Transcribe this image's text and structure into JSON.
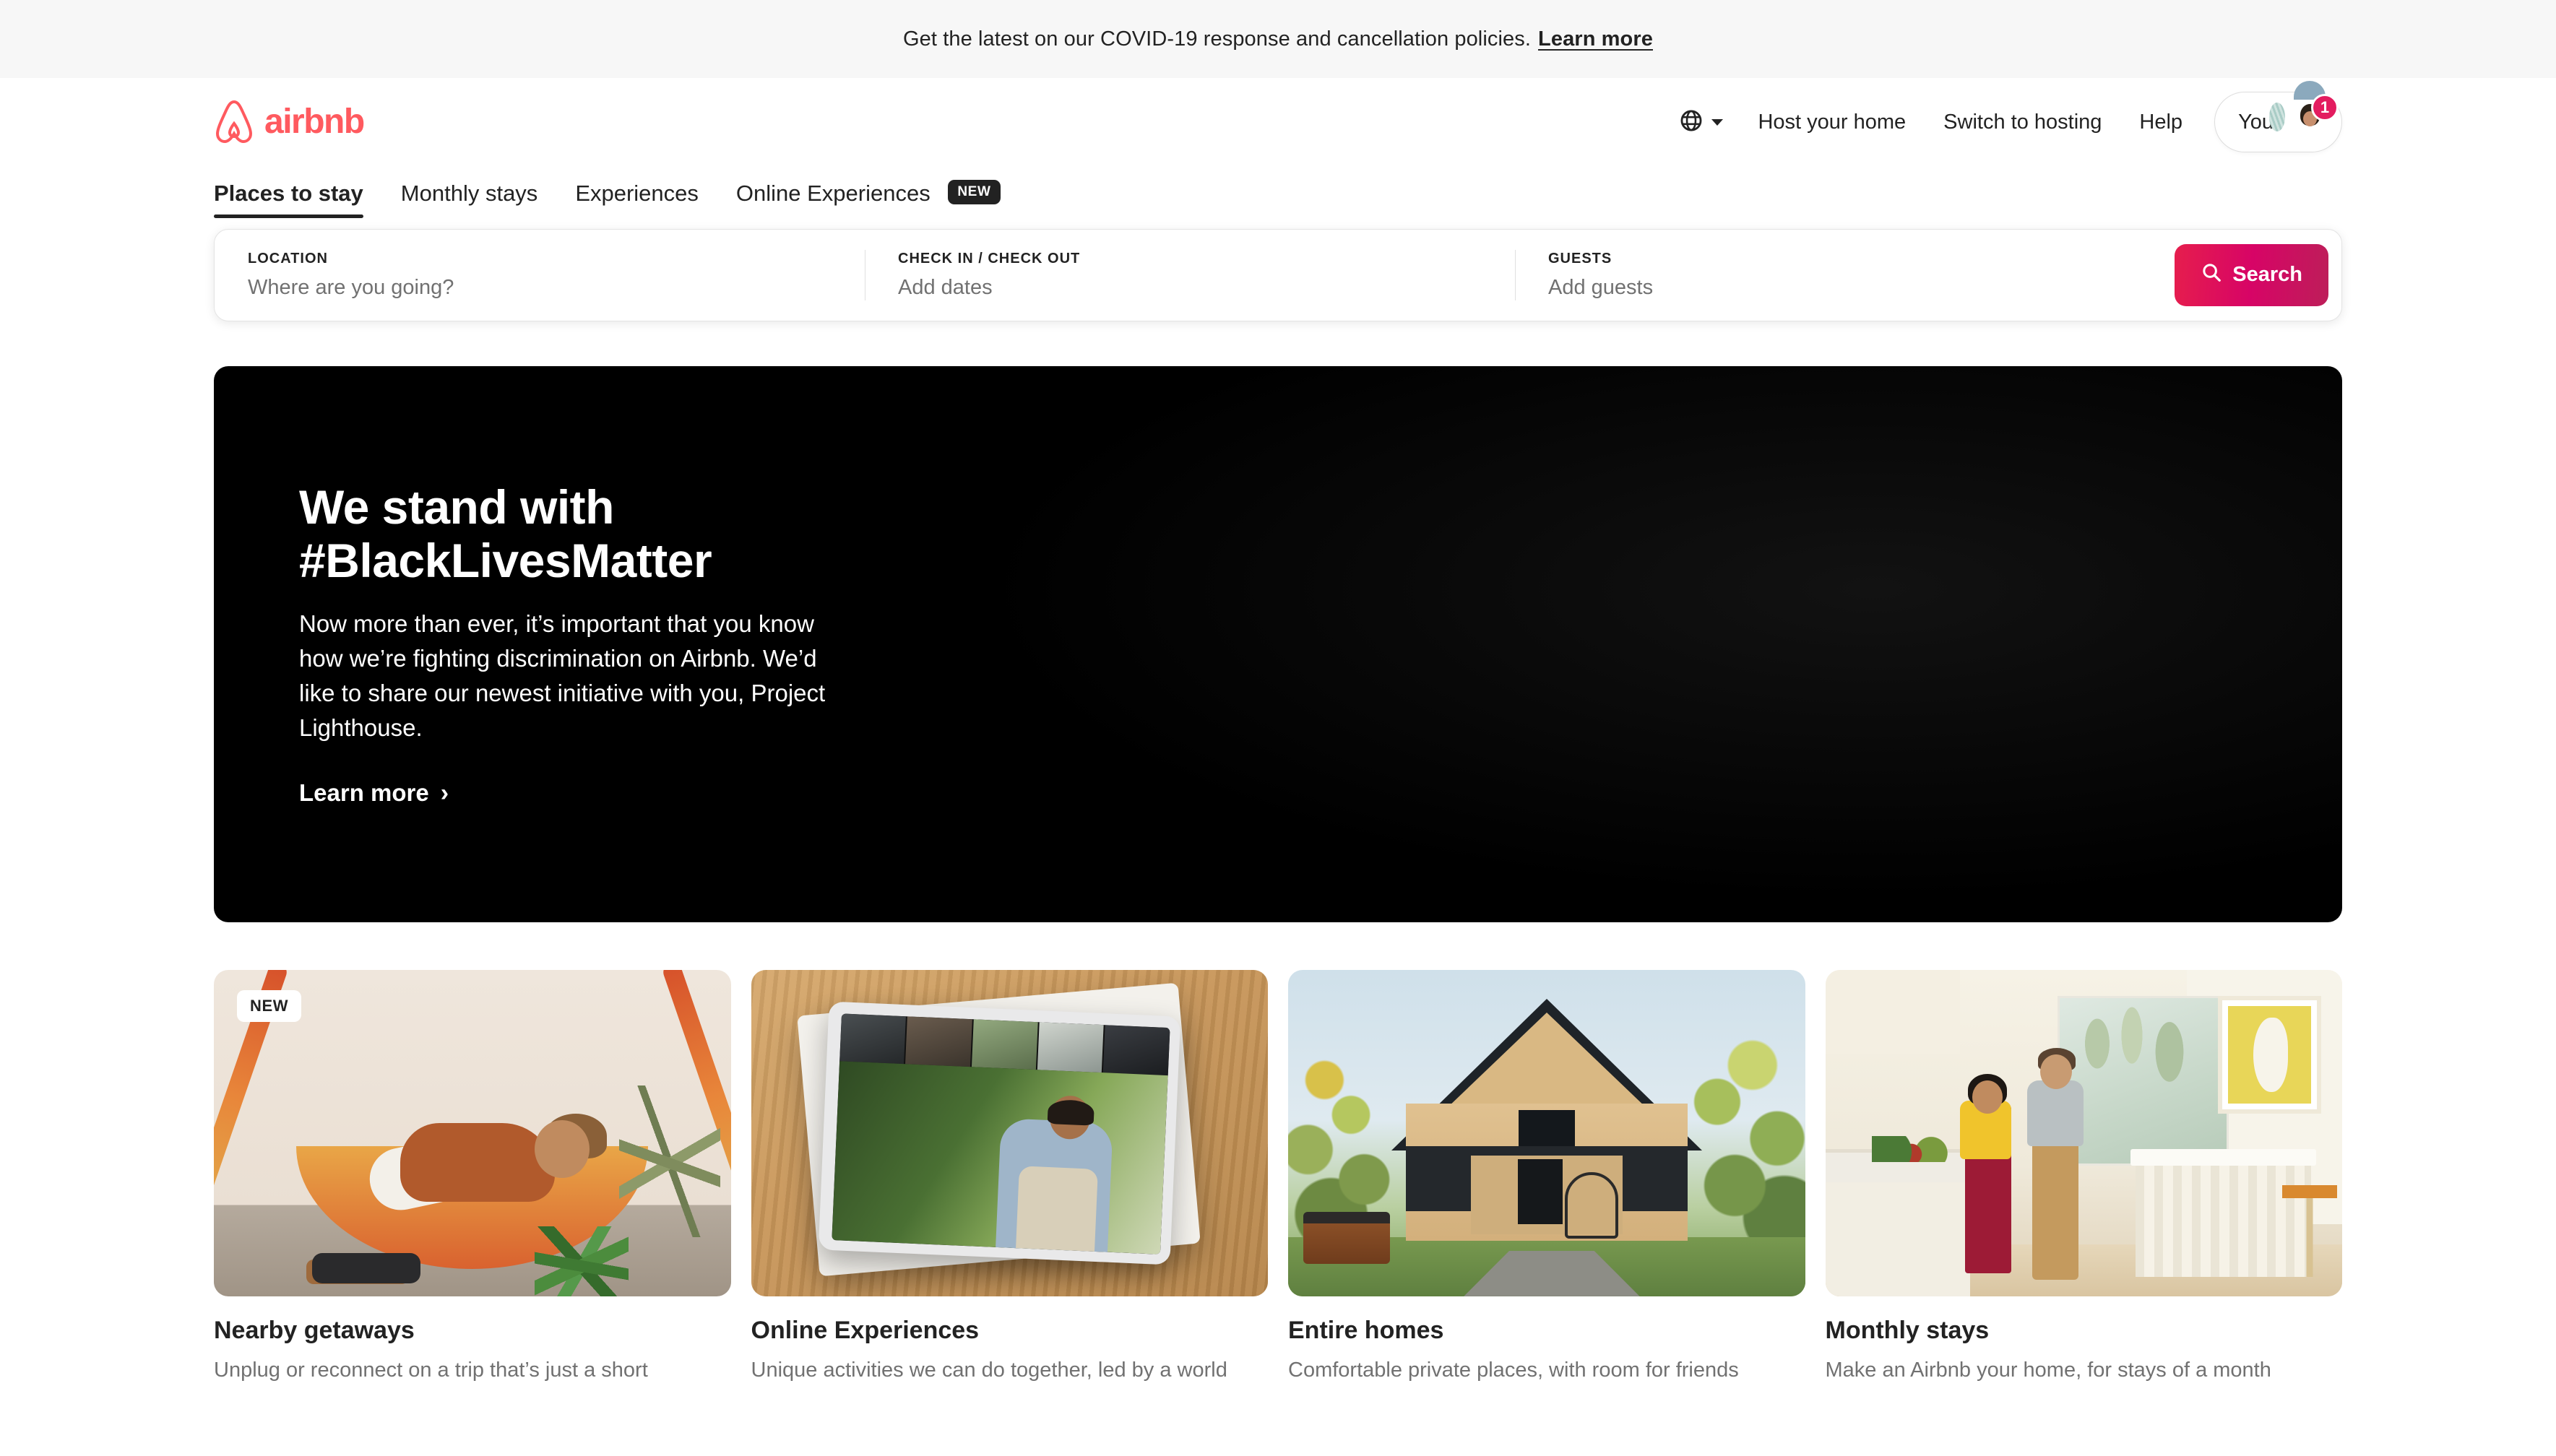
{
  "banner": {
    "text": "Get the latest on our COVID-19 response and cancellation policies.",
    "link_label": "Learn more"
  },
  "header": {
    "logo_text": "airbnb",
    "brand_color": "#FF5A5F",
    "globe_icon": "globe-icon",
    "nav": [
      {
        "label": "Host your home"
      },
      {
        "label": "Switch to hosting"
      },
      {
        "label": "Help"
      }
    ],
    "account": {
      "label": "You",
      "notification_count": "1",
      "badge_color": "#e31c5f"
    }
  },
  "tabs": [
    {
      "label": "Places to stay",
      "active": true,
      "badge": ""
    },
    {
      "label": "Monthly stays",
      "active": false,
      "badge": ""
    },
    {
      "label": "Experiences",
      "active": false,
      "badge": ""
    },
    {
      "label": "Online Experiences",
      "active": false,
      "badge": "NEW"
    }
  ],
  "search": {
    "location": {
      "label": "LOCATION",
      "placeholder": "Where are you going?",
      "value": ""
    },
    "dates": {
      "label": "CHECK IN / CHECK OUT",
      "placeholder": "Add dates",
      "value": ""
    },
    "guests": {
      "label": "GUESTS",
      "placeholder": "Add guests",
      "value": ""
    },
    "button_label": "Search",
    "button_icon": "search-icon",
    "button_color": "#d70466"
  },
  "hero": {
    "title_line1": "We stand with",
    "title_line2": "#BlackLivesMatter",
    "body": "Now more than ever, it’s important that you know how we’re fighting discrimination on Airbnb. We’d like to share our newest initiative with you, Project Lighthouse.",
    "link_label": "Learn more",
    "link_arrow": "›",
    "background_color": "#000000"
  },
  "cards": [
    {
      "badge": "NEW",
      "title": "Nearby getaways",
      "description": "Unplug or reconnect on a trip that’s just a short",
      "image": "hammock-photo"
    },
    {
      "badge": "",
      "title": "Online Experiences",
      "description": "Unique activities we can do together, led by a world",
      "image": "tablet-video-call-photo"
    },
    {
      "badge": "",
      "title": "Entire homes",
      "description": "Comfortable private places, with room for friends",
      "image": "a-frame-cabin-photo"
    },
    {
      "badge": "",
      "title": "Monthly stays",
      "description": "Make an Airbnb your home, for stays of a month",
      "image": "kitchen-couple-photo"
    }
  ]
}
